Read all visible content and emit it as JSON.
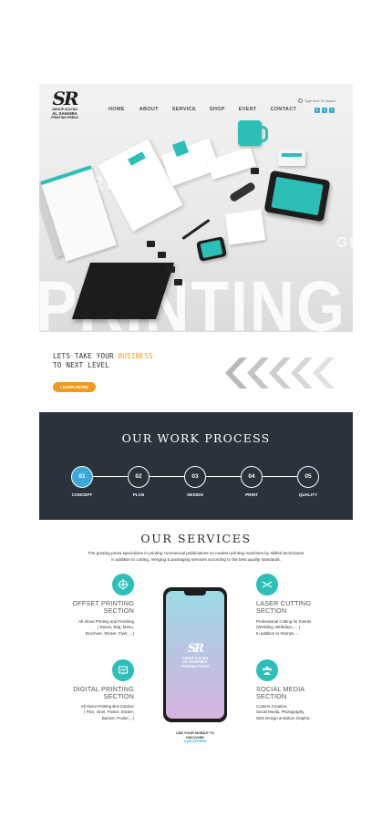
{
  "brand": {
    "mark": "SR",
    "line1": "GROUP SULTAN",
    "line2": "AL SAHAIBA",
    "line3": "PRINTING PRESS"
  },
  "nav": {
    "items": [
      "HOME",
      "ABOUT",
      "SERVICE",
      "SHOP",
      "EVENT",
      "CONTACT"
    ]
  },
  "search": {
    "placeholder": "Type Here To Search"
  },
  "social": {
    "icons": [
      "facebook-icon",
      "twitter-icon",
      "instagram-icon"
    ],
    "color": "#3aa9d9"
  },
  "hero": {
    "big_word": "PRINTING PRESS",
    "side_word_left": "G PRINTING GIFTS",
    "side_word_right": "GI"
  },
  "tagline": {
    "prefix": "LETS TAKE YOUR ",
    "highlight": "BUSINESS",
    "line2": "TO NEXT LEVEL",
    "button": "LEARN MORE",
    "accent": "#f29a1a"
  },
  "process": {
    "title": "OUR WORK PROCESS",
    "steps": [
      {
        "num": "01",
        "label": "CONCEPT"
      },
      {
        "num": "02",
        "label": "PLAN"
      },
      {
        "num": "03",
        "label": "DESIGN"
      },
      {
        "num": "04",
        "label": "PRINT"
      },
      {
        "num": "05",
        "label": "QUALITY"
      }
    ],
    "background": "#2a323c",
    "active_color": "#3aa9d9"
  },
  "services": {
    "title": "OUR SERVICES",
    "desc_line1": "The printing press specializes in printing commercial publications on modern printing machines by skilled technicians",
    "desc_line2": "in addition to cutting, merging & packaging services according to the best quality standards.",
    "icon_color": "#2cbfb8",
    "offset": {
      "name1": "OFFSET PRINTING",
      "name2": "SECTION",
      "lines": [
        "All About Printing and Finishing",
        "( Boxes, Bag, Menu,",
        "Brochure, Sticker, Flyer, ...)"
      ]
    },
    "laser": {
      "name1": "LASER CUTTING",
      "name2": "SECTION",
      "lines": [
        "Professional Cutting for Events",
        "(Wedding, Birthdays, ... )",
        "In addition to Stamps,..."
      ]
    },
    "digital": {
      "name1": "DIGITAL PRINTING",
      "name2": "SECTION",
      "lines": [
        "All About Printing But Outdoor",
        "( Flex, Vinel, Poster, Sticker,",
        "Banner, Poster,...)"
      ]
    },
    "social": {
      "name1": "SOCIAL MEDIA",
      "name2": "SECTION",
      "lines": [
        "Content Creation,",
        "Social Media, Photography,",
        "Web Design & Motion Graphic"
      ]
    },
    "phone": {
      "mark": "SR",
      "line1": "GROUP SULTAN",
      "line2": "AL SAHAIBA",
      "line3": "PRINTING PRESS"
    },
    "download_line1": "USE YOUR MOBILE TO",
    "download_line2": "DISCOVER",
    "download_link": "OUR OFFERS"
  }
}
